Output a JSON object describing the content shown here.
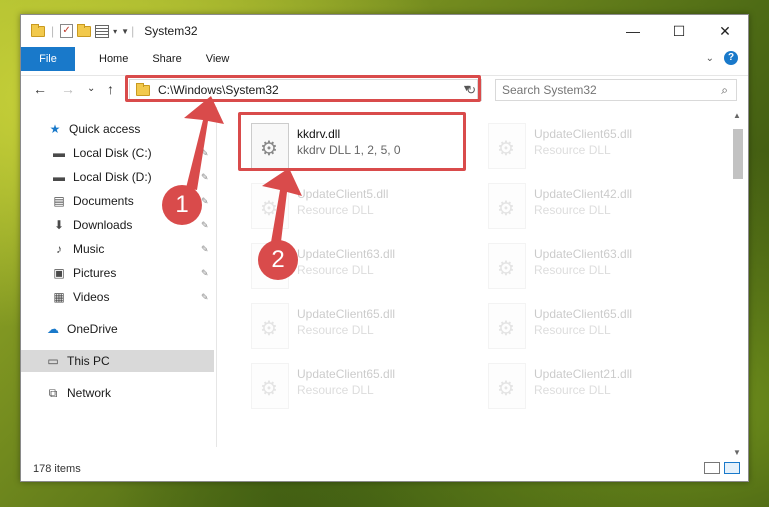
{
  "window": {
    "title": "System32",
    "minimize_glyph": "—",
    "maximize_glyph": "☐",
    "close_glyph": "✕"
  },
  "ribbon": {
    "tabs": [
      "File",
      "Home",
      "Share",
      "View"
    ],
    "help_glyph": "?",
    "collapse_glyph": "⌄"
  },
  "nav": {
    "back": "←",
    "forward": "→",
    "recent": "⌄",
    "up": "↑",
    "address": "C:\\Windows\\System32",
    "refresh": "↻",
    "search_placeholder": "Search System32",
    "search_icon": "⌕"
  },
  "sidebar": [
    {
      "label": "Quick access",
      "icon": "★",
      "pinned": false
    },
    {
      "label": "Local Disk (C:)",
      "icon": "▬",
      "pinned": true
    },
    {
      "label": "Local Disk (D:)",
      "icon": "▬",
      "pinned": true
    },
    {
      "label": "Documents",
      "icon": "▤",
      "pinned": true
    },
    {
      "label": "Downloads",
      "icon": "⬇",
      "pinned": true
    },
    {
      "label": "Music",
      "icon": "♪",
      "pinned": true
    },
    {
      "label": "Pictures",
      "icon": "▣",
      "pinned": true
    },
    {
      "label": "Videos",
      "icon": "▦",
      "pinned": true
    },
    {
      "label": "OneDrive",
      "icon": "☁",
      "pinned": false
    },
    {
      "label": "This PC",
      "icon": "▭",
      "pinned": false
    },
    {
      "label": "Network",
      "icon": "⧉",
      "pinned": false
    }
  ],
  "pin_glyph": "✎",
  "files": [
    {
      "name": "kkdrv.dll",
      "desc": "kkdrv DLL 1, 2, 5, 0",
      "faded": false
    },
    {
      "name": "UpdateClient65.dll",
      "desc": "Resource DLL",
      "faded": true
    },
    {
      "name": "UpdateClient5.dll",
      "desc": "Resource DLL",
      "faded": true
    },
    {
      "name": "UpdateClient42.dll",
      "desc": "Resource DLL",
      "faded": true
    },
    {
      "name": "UpdateClient63.dll",
      "desc": "Resource DLL",
      "faded": true
    },
    {
      "name": "UpdateClient63.dll",
      "desc": "Resource DLL",
      "faded": true
    },
    {
      "name": "UpdateClient65.dll",
      "desc": "Resource DLL",
      "faded": true
    },
    {
      "name": "UpdateClient65.dll",
      "desc": "Resource DLL",
      "faded": true
    },
    {
      "name": "UpdateClient65.dll",
      "desc": "Resource DLL",
      "faded": true
    },
    {
      "name": "UpdateClient21.dll",
      "desc": "Resource DLL",
      "faded": true
    }
  ],
  "status": {
    "items": "178 items"
  },
  "annotations": {
    "step1": "1",
    "step2": "2",
    "color": "#d94b4b"
  }
}
